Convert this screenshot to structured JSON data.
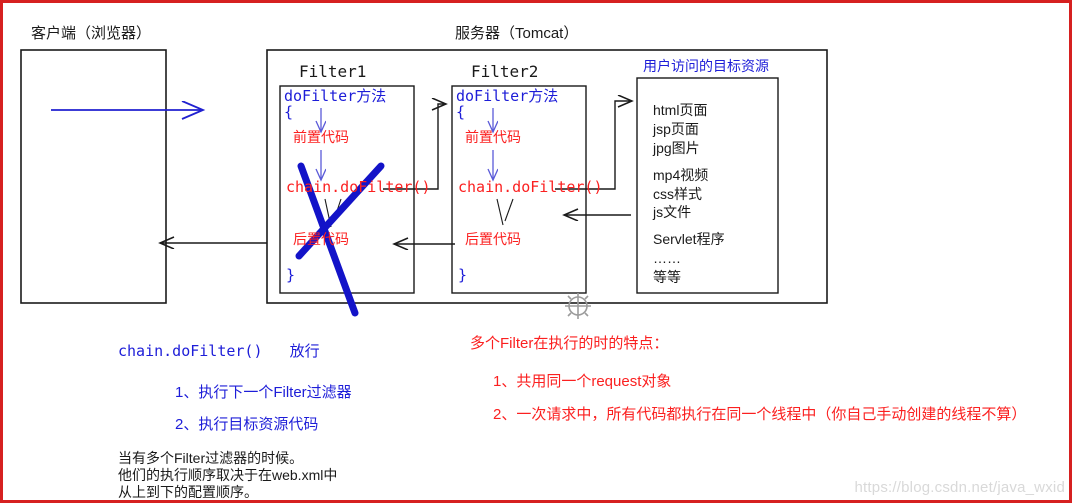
{
  "diagram": {
    "title_client": "客户端（浏览器）",
    "title_server": "服务器（Tomcat）",
    "filter1": {
      "name": "Filter1",
      "method": "doFilter方法",
      "brace_open": "{",
      "pre_code": "前置代码",
      "chain_call": "chain.doFilter()",
      "post_code": "后置代码",
      "brace_close": "}"
    },
    "filter2": {
      "name": "Filter2",
      "method": "doFilter方法",
      "brace_open": "{",
      "pre_code": "前置代码",
      "chain_call": "chain.doFilter()",
      "post_code": "后置代码",
      "brace_close": "}"
    },
    "resource": {
      "title": "用户访问的目标资源",
      "items": [
        "html页面",
        "jsp页面",
        "jpg图片",
        "",
        "mp4视频",
        "css样式",
        "js文件",
        "",
        "Servlet程序",
        "……",
        "等等"
      ]
    }
  },
  "notes_left": {
    "heading": "chain.doFilter()   放行",
    "items": [
      "1、执行下一个Filter过滤器",
      "2、执行目标资源代码"
    ],
    "footer": [
      "当有多个Filter过滤器的时候。",
      "他们的执行顺序取决于在web.xml中",
      "从上到下的配置顺序。"
    ]
  },
  "notes_right": {
    "heading": "多个Filter在执行的时的特点：",
    "items": [
      "1、共用同一个request对象",
      "2、一次请求中，所有代码都执行在同一个线程中（你自己手动创建的线程不算）"
    ]
  },
  "watermark": {
    "text": "https://blog.csdn.net/java_wxid"
  },
  "icons": {
    "move_handle": "move-crosshair-icon",
    "strike_through": "blue-cross-out-mark"
  },
  "colors": {
    "frame": "#d62020",
    "blue_text": "#1d1dd8",
    "red_text": "#fb2020",
    "black_text": "#1a1a1a",
    "blue_arrow": "#2020d0",
    "blue_strike": "#1313c8",
    "watermark": "#d9d9d9"
  }
}
